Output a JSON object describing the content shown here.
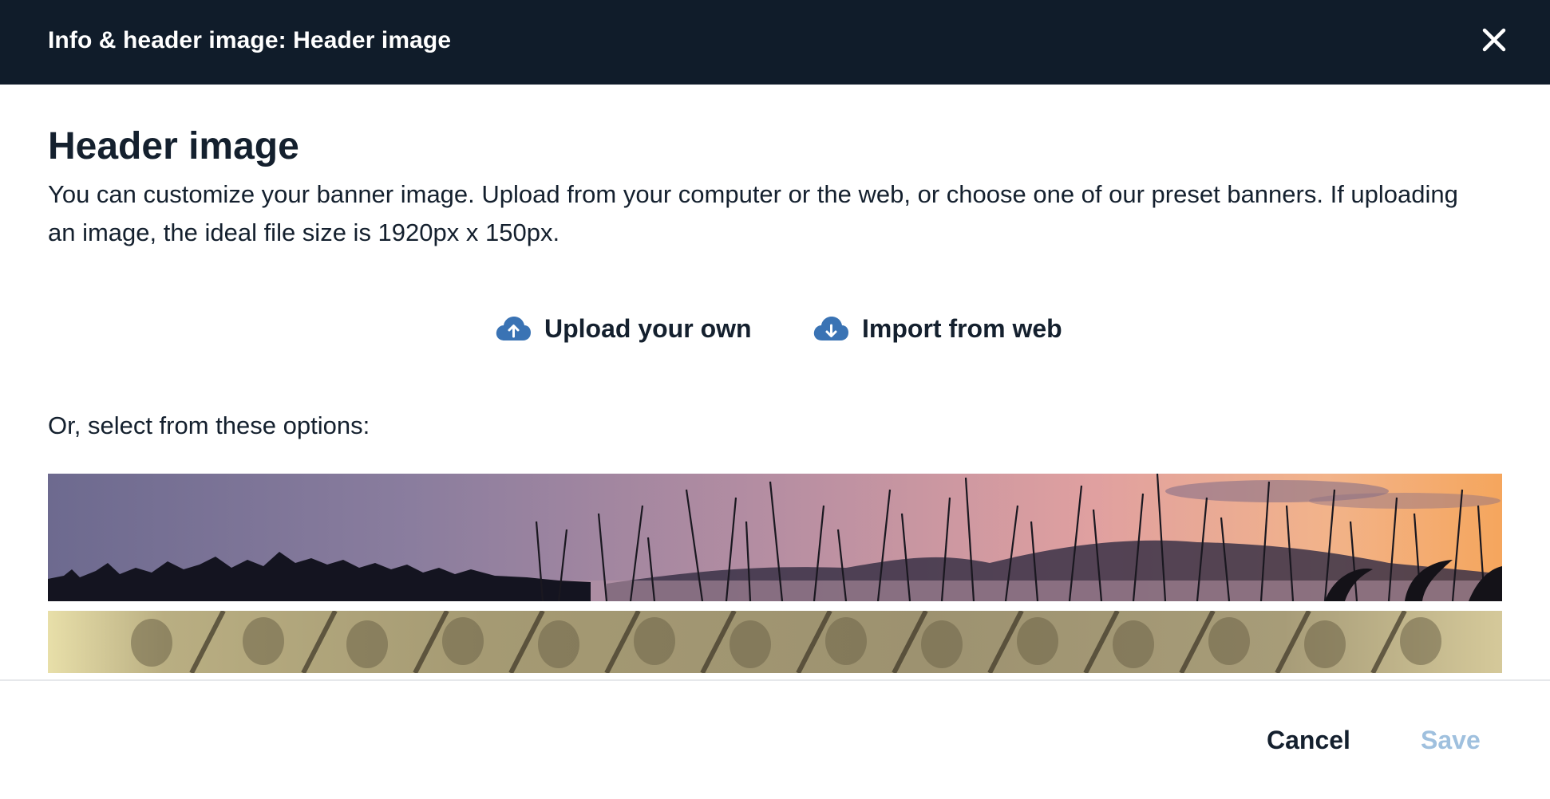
{
  "dialog": {
    "title": "Info & header image: Header image",
    "close_icon": "close-icon"
  },
  "section": {
    "heading": "Header image",
    "description": "You can customize your banner image. Upload from your computer or the web, or choose one of our preset banners. If uploading an image, the ideal file size is 1920px x 150px."
  },
  "actions": {
    "upload": {
      "label": "Upload your own",
      "icon": "cloud-upload-icon"
    },
    "import": {
      "label": "Import from web",
      "icon": "cloud-download-icon"
    }
  },
  "options": {
    "label": "Or, select from these options:",
    "banners": [
      {
        "name": "lake-sunset-banner"
      },
      {
        "name": "soldiers-sepia-banner"
      }
    ]
  },
  "footer": {
    "cancel_label": "Cancel",
    "save_label": "Save"
  },
  "colors": {
    "titlebar_bg": "#101c2a",
    "accent_blue": "#3a73b4",
    "save_disabled": "#9fc0de",
    "text_dark": "#14202e"
  }
}
